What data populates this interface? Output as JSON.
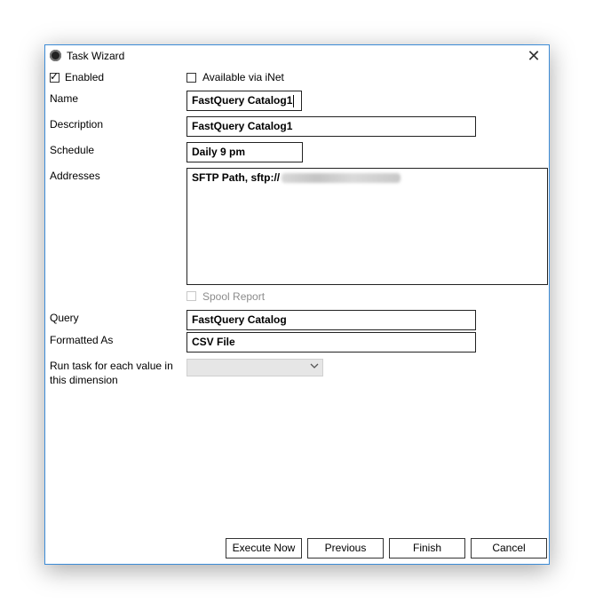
{
  "window": {
    "title": "Task Wizard",
    "close_glyph": "✕"
  },
  "form": {
    "enabled": {
      "label": "Enabled",
      "checked": true
    },
    "available_inet": {
      "label": "Available via iNet",
      "checked": false
    },
    "name": {
      "label": "Name",
      "value": "FastQuery Catalog1"
    },
    "description": {
      "label": "Description",
      "value": "FastQuery Catalog1"
    },
    "schedule": {
      "label": "Schedule",
      "value": "Daily 9 pm"
    },
    "addresses": {
      "label": "Addresses",
      "value": "SFTP Path, sftp://"
    },
    "spool_report": {
      "label": "Spool Report",
      "checked": false,
      "enabled": false
    },
    "query": {
      "label": "Query",
      "value": "FastQuery Catalog"
    },
    "formatted_as": {
      "label": "Formatted As",
      "value": "CSV File"
    },
    "run_for_each": {
      "label_line1": "Run task for each value in",
      "label_line2": "this dimension",
      "value": ""
    }
  },
  "buttons": {
    "execute_now": "Execute Now",
    "previous": "Previous",
    "finish": "Finish",
    "cancel": "Cancel"
  },
  "icons": {
    "app": "app-logo-icon",
    "close": "close-icon",
    "check": "checkmark-icon",
    "dropdown": "chevron-down-icon"
  },
  "colors": {
    "window_border": "#3c8bd6",
    "field_border": "#222222",
    "disabled_text": "#8c8c8c"
  }
}
